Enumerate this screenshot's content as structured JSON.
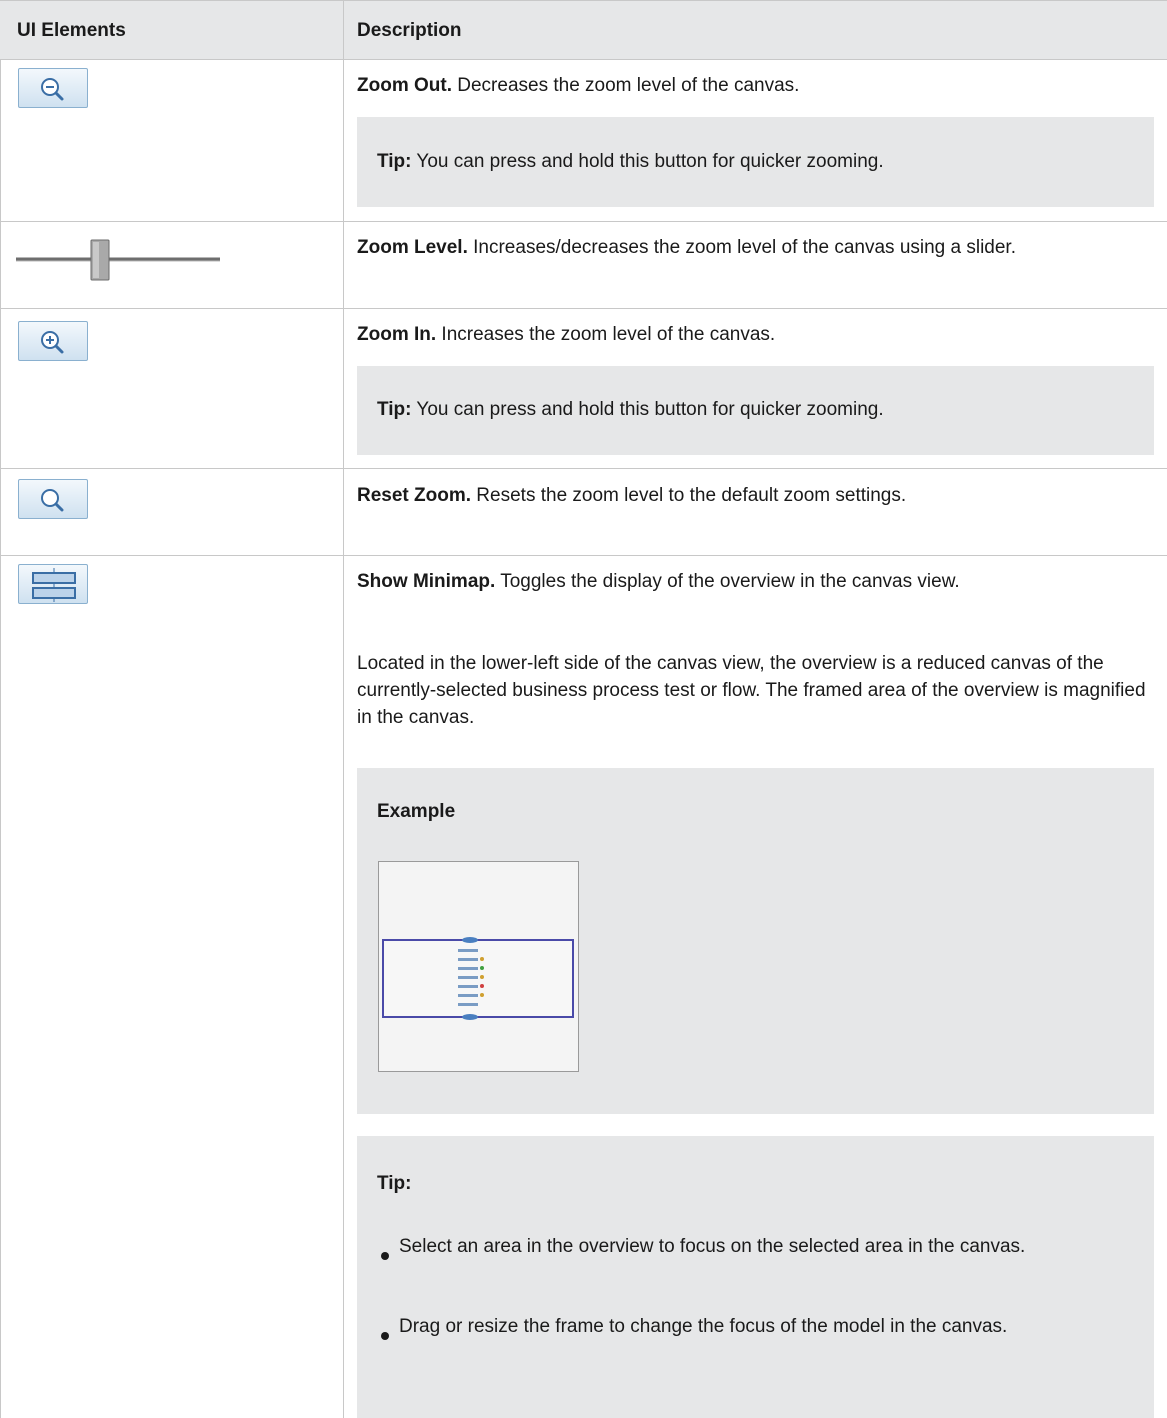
{
  "header": {
    "col1": "UI Elements",
    "col2": "Description"
  },
  "rows": [
    {
      "title": "Zoom Out.",
      "text": " Decreases the zoom level of the canvas.",
      "tip_label": "Tip:",
      "tip_text": " You can press and hold this button for quicker zooming."
    },
    {
      "title": "Zoom Level.",
      "text": " Increases/decreases the zoom level of the canvas using a slider."
    },
    {
      "title": "Zoom In.",
      "text": " Increases the zoom level of the canvas.",
      "tip_label": "Tip:",
      "tip_text": " You can press and hold this button for quicker zooming."
    },
    {
      "title": "Reset Zoom.",
      "text": " Resets the zoom level to the default zoom settings."
    },
    {
      "title": "Show Minimap.",
      "text": " Toggles the display of the overview in the canvas view.",
      "para": "Located in the lower-left side of the canvas view, the overview is a reduced canvas of the currently-selected business process test or flow. The framed area of the overview is magnified in the canvas.",
      "example_label": "Example",
      "tip_label": "Tip:",
      "bullets": [
        "Select an area in the overview to focus on the selected area in the canvas.",
        "Drag or resize the frame to change the focus of the model in the canvas."
      ]
    }
  ],
  "icons": {
    "zoom_out": "zoom-out-icon",
    "zoom_slider": "zoom-slider-icon",
    "zoom_in": "zoom-in-icon",
    "reset_zoom": "reset-zoom-icon",
    "minimap": "minimap-icon"
  },
  "colors": {
    "header_bg": "#e6e7e8",
    "tip_bg": "#e6e7e8",
    "border": "#c8c8c8",
    "icon_accent": "#3a6ea5"
  }
}
